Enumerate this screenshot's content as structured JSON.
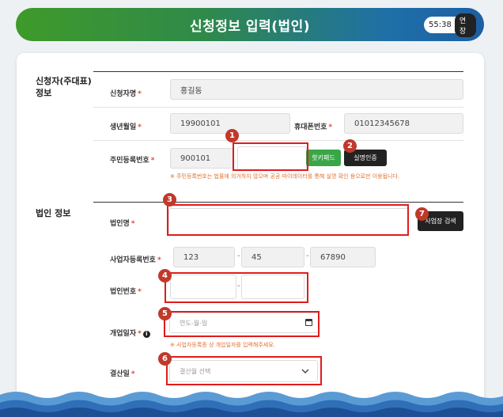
{
  "header": {
    "title": "신청정보 입력(법인)",
    "timer": "55:38",
    "extend": "연장"
  },
  "applicant": {
    "section_title": "신청자(주대표)\n정보",
    "name_label": "신청자명",
    "name_value": "홍길동",
    "birth_label": "생년월일",
    "birth_value": "19900101",
    "phone_label": "휴대폰번호",
    "phone_value": "01012345678",
    "rrn_label": "주민등록번호",
    "rrn_front": "900101",
    "virtual_keypad_button": "핫키패드",
    "verify_button": "실명인증",
    "rrn_hint": "※ 주민등록번호는 법률에 의거하지 않으며 공공 마이데이터를 통해 실명 확인 용으로만 이용됩니다."
  },
  "corp": {
    "section_title": "법인 정보",
    "name_label": "법인명",
    "search_button": "사업장 검색",
    "bizno_label": "사업자등록번호",
    "bizno": [
      "123",
      "45",
      "67890"
    ],
    "corpno_label": "법인번호",
    "open_label": "개업일자",
    "date_placeholder": "연도-월-일",
    "open_hint": "※ 사업자등록증 상 개업일자를 입력해주세요.",
    "settle_label": "결산일",
    "settle_placeholder": "결산월 선택"
  },
  "badges": [
    "1",
    "2",
    "3",
    "4",
    "5",
    "6",
    "7"
  ],
  "colors": {
    "accent_green": "#3aa648",
    "highlight": "#e21b1b",
    "badge": "#c0392b",
    "header_start": "#3f9a2a",
    "header_end": "#1b5fa3"
  }
}
